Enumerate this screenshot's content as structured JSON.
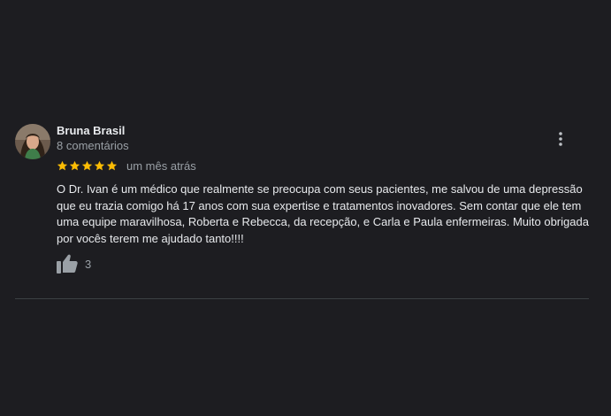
{
  "review": {
    "author": {
      "name": "Bruna Brasil",
      "meta": "8 comentários",
      "avatar_icon": "user-photo-avatar"
    },
    "rating": {
      "stars": 5,
      "max": 5,
      "star_color": "#fbbc04"
    },
    "date": "um mês atrás",
    "text": "O Dr. Ivan é um médico que realmente se preocupa com seus pacientes, me salvou de uma depressão que eu trazia comigo há 17 anos com sua expertise e tratamentos inovadores. Sem contar que ele tem uma equipe maravilhosa, Roberta e Rebecca, da recepção, e Carla e Paula enfermeiras. Muito obrigada por vocês terem me ajudado tanto!!!!",
    "likes": "3",
    "more_icon": "more-vertical-icon",
    "like_icon": "thumbs-up-icon"
  },
  "colors": {
    "background": "#1d1d21",
    "text_primary": "#e8eaed",
    "text_secondary": "#9aa0a6",
    "divider": "#3c4043"
  }
}
